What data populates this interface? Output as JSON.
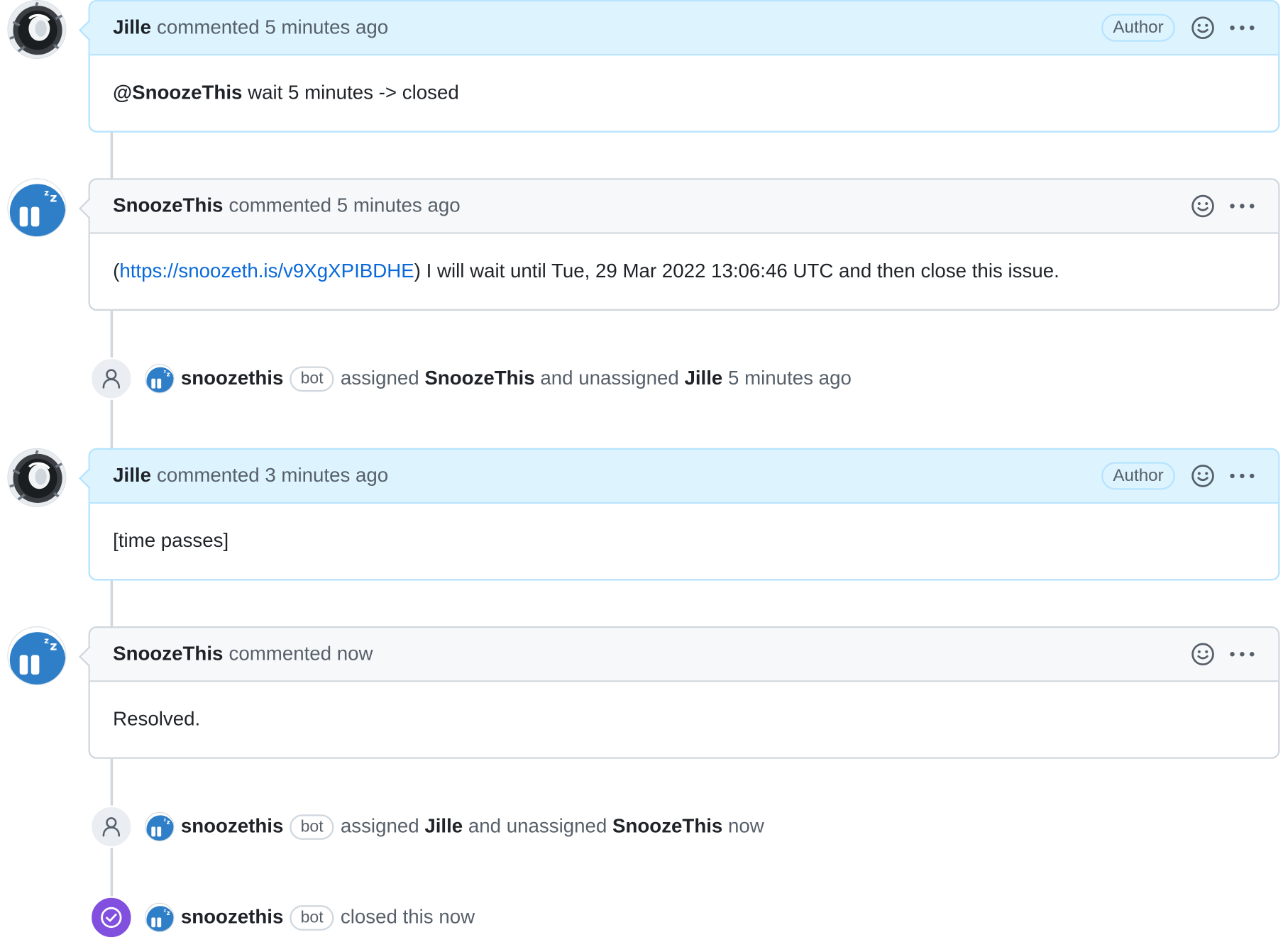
{
  "timeline": [
    {
      "kind": "comment",
      "author": "Jille",
      "action": "commented",
      "time": "5 minutes ago",
      "badge": "Author",
      "is_author": true,
      "mention": "@SnoozeThis",
      "body": "wait 5 minutes -> closed"
    },
    {
      "kind": "comment",
      "author": "SnoozeThis",
      "action": "commented",
      "time": "5 minutes ago",
      "is_author": false,
      "body_prefix": "(",
      "link": "https://snoozeth.is/v9XgXPIBDHE",
      "body": ") I will wait until Tue, 29 Mar 2022 13:06:46 UTC and then close this issue."
    },
    {
      "kind": "event",
      "actor": "snoozethis",
      "actor_badge": "bot",
      "verb1": "assigned",
      "target1": "SnoozeThis",
      "verb2": "and unassigned",
      "target2": "Jille",
      "time": "5 minutes ago"
    },
    {
      "kind": "comment",
      "author": "Jille",
      "action": "commented",
      "time": "3 minutes ago",
      "badge": "Author",
      "is_author": true,
      "body": "[time passes]"
    },
    {
      "kind": "comment",
      "author": "SnoozeThis",
      "action": "commented",
      "time": "now",
      "is_author": false,
      "body": "Resolved."
    },
    {
      "kind": "event",
      "actor": "snoozethis",
      "actor_badge": "bot",
      "verb1": "assigned",
      "target1": "Jille",
      "verb2": "and unassigned",
      "target2": "SnoozeThis",
      "time": "now"
    },
    {
      "kind": "closed-event",
      "actor": "snoozethis",
      "actor_badge": "bot",
      "text": "closed this",
      "time": "now"
    }
  ],
  "icons": {
    "reaction": "smiley-icon",
    "more": "kebab-horizontal-icon",
    "assign_event": "person-icon",
    "closed_event": "check-circle-icon"
  },
  "colors": {
    "author_header_bg": "#ddf4ff",
    "author_border": "#b6e3ff",
    "link": "#0969da",
    "closed_badge": "#8250df",
    "bot_avatar": "#2f7fc8"
  }
}
